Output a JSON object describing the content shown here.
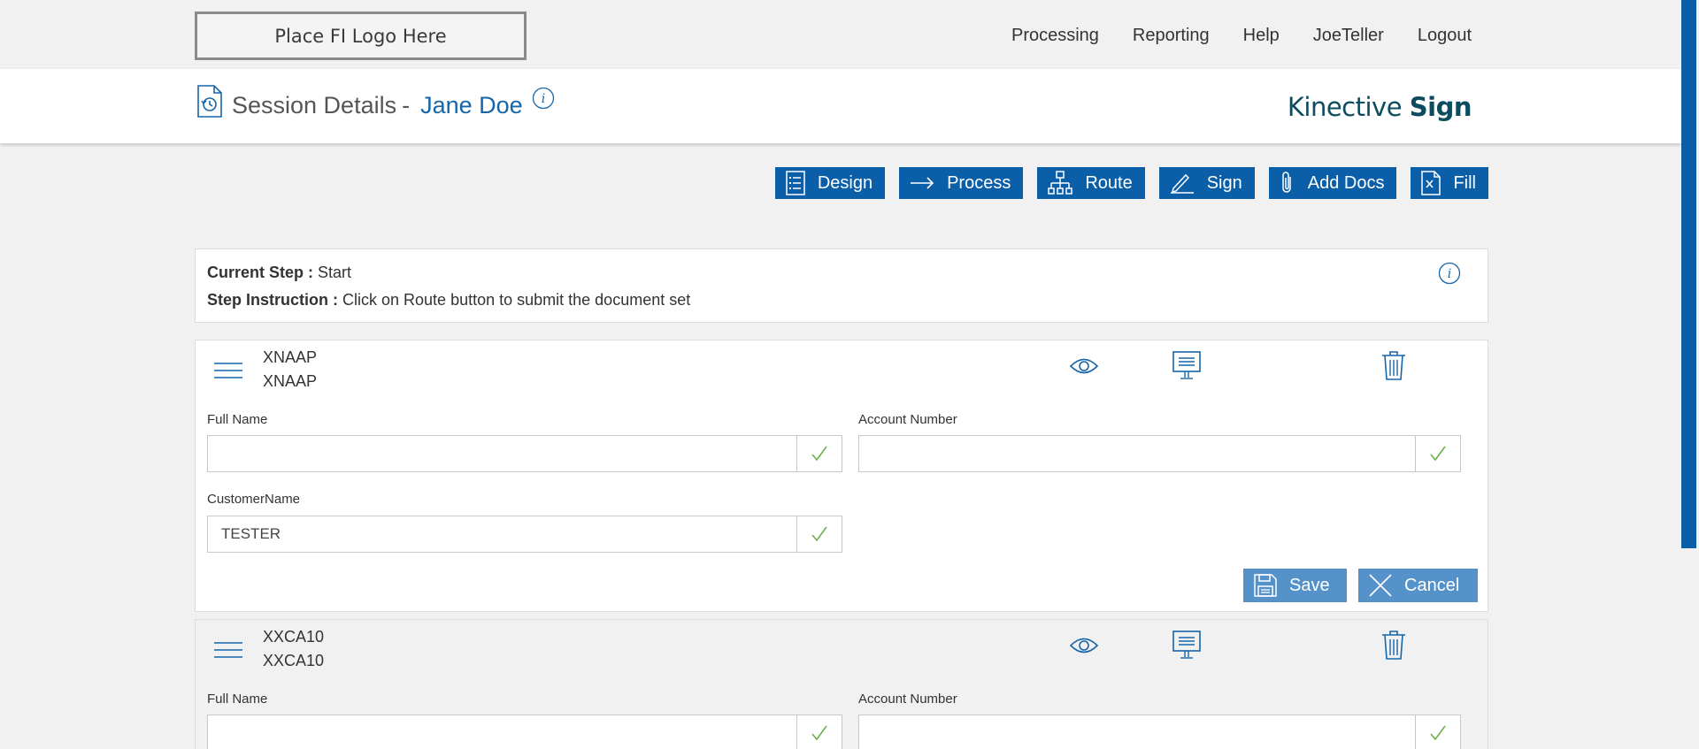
{
  "logo": {
    "text": "Place FI Logo Here"
  },
  "nav": {
    "items": [
      "Processing",
      "Reporting",
      "Help",
      "JoeTeller",
      "Logout"
    ]
  },
  "header": {
    "title": "Session Details",
    "separator": "-",
    "customer_name": "Jane Doe",
    "brand_light": "Kinective",
    "brand_bold": "Sign"
  },
  "toolbar": {
    "design": "Design",
    "process": "Process",
    "route": "Route",
    "sign": "Sign",
    "add_docs": "Add Docs",
    "fill": "Fill"
  },
  "step": {
    "current_label": "Current Step :",
    "current_value": "Start",
    "instruction_label": "Step Instruction :",
    "instruction_value": "Click on Route button to submit the document set"
  },
  "documents": [
    {
      "code": "XNAAP",
      "name": "XNAAP",
      "fields": {
        "full_name_label": "Full Name",
        "full_name_value": "",
        "account_number_label": "Account Number",
        "account_number_value": "",
        "customer_name_label": "CustomerName",
        "customer_name_value": "TESTER"
      },
      "save_label": "Save",
      "cancel_label": "Cancel"
    },
    {
      "code": "XXCA10",
      "name": "XXCA10",
      "fields": {
        "full_name_label": "Full Name",
        "full_name_value": "",
        "account_number_label": "Account Number",
        "account_number_value": ""
      }
    }
  ],
  "colors": {
    "primary": "#0b5ea8",
    "accent_text": "#1565a9",
    "check_green": "#6ab04c",
    "secondary_button": "#5592c9"
  }
}
